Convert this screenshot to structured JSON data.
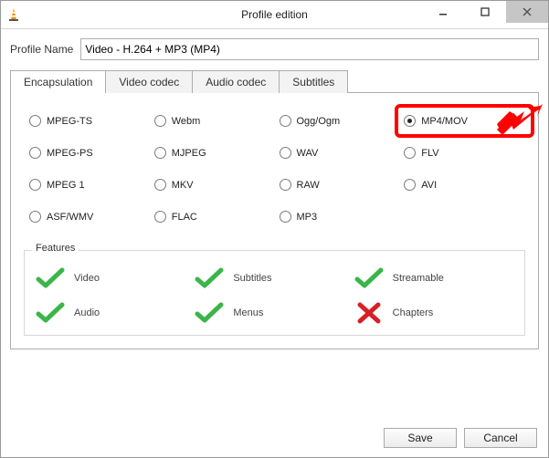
{
  "window": {
    "title": "Profile edition"
  },
  "profile": {
    "label": "Profile Name",
    "value": "Video - H.264 + MP3 (MP4)"
  },
  "tabs": [
    {
      "label": "Encapsulation",
      "active": true
    },
    {
      "label": "Video codec",
      "active": false
    },
    {
      "label": "Audio codec",
      "active": false
    },
    {
      "label": "Subtitles",
      "active": false
    }
  ],
  "encapsulation": {
    "options": [
      {
        "label": "MPEG-TS",
        "checked": false
      },
      {
        "label": "Webm",
        "checked": false
      },
      {
        "label": "Ogg/Ogm",
        "checked": false
      },
      {
        "label": "MP4/MOV",
        "checked": true,
        "highlighted": true
      },
      {
        "label": "MPEG-PS",
        "checked": false
      },
      {
        "label": "MJPEG",
        "checked": false
      },
      {
        "label": "WAV",
        "checked": false
      },
      {
        "label": "FLV",
        "checked": false
      },
      {
        "label": "MPEG 1",
        "checked": false
      },
      {
        "label": "MKV",
        "checked": false
      },
      {
        "label": "RAW",
        "checked": false
      },
      {
        "label": "AVI",
        "checked": false
      },
      {
        "label": "ASF/WMV",
        "checked": false
      },
      {
        "label": "FLAC",
        "checked": false
      },
      {
        "label": "MP3",
        "checked": false
      }
    ]
  },
  "features": {
    "legend": "Features",
    "items": [
      {
        "label": "Video",
        "supported": true
      },
      {
        "label": "Subtitles",
        "supported": true
      },
      {
        "label": "Streamable",
        "supported": true
      },
      {
        "label": "Audio",
        "supported": true
      },
      {
        "label": "Menus",
        "supported": true
      },
      {
        "label": "Chapters",
        "supported": false
      }
    ]
  },
  "buttons": {
    "save": "Save",
    "cancel": "Cancel"
  }
}
